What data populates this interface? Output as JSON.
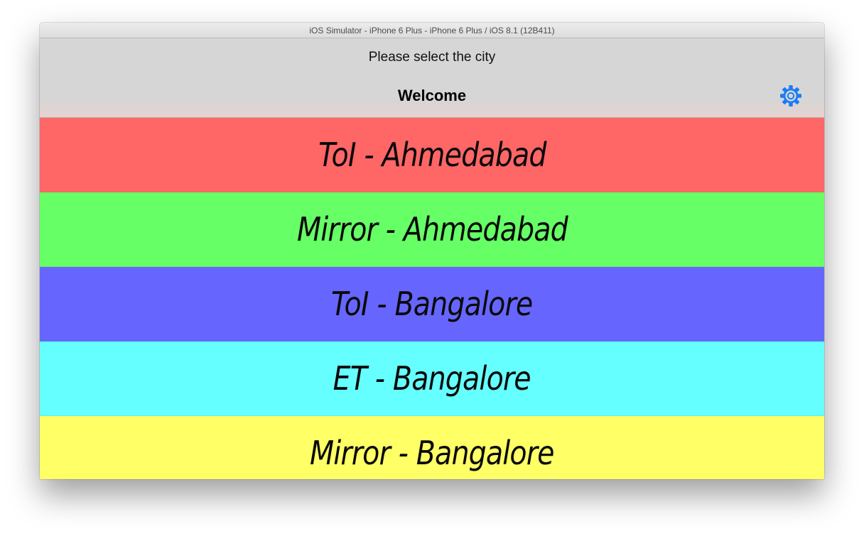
{
  "window": {
    "title": "iOS Simulator - iPhone 6 Plus - iPhone 6 Plus / iOS 8.1 (12B411)"
  },
  "app": {
    "prompt": "Please select the city",
    "nav_title": "Welcome",
    "settings_icon": "gear-icon",
    "accent_color": "#1a7cf5"
  },
  "cities": [
    {
      "label": "ToI - Ahmedabad",
      "color": "#ff6666"
    },
    {
      "label": "Mirror - Ahmedabad",
      "color": "#66ff66"
    },
    {
      "label": "ToI - Bangalore",
      "color": "#6666ff"
    },
    {
      "label": "ET - Bangalore",
      "color": "#66ffff"
    },
    {
      "label": "Mirror - Bangalore",
      "color": "#ffff66"
    }
  ]
}
